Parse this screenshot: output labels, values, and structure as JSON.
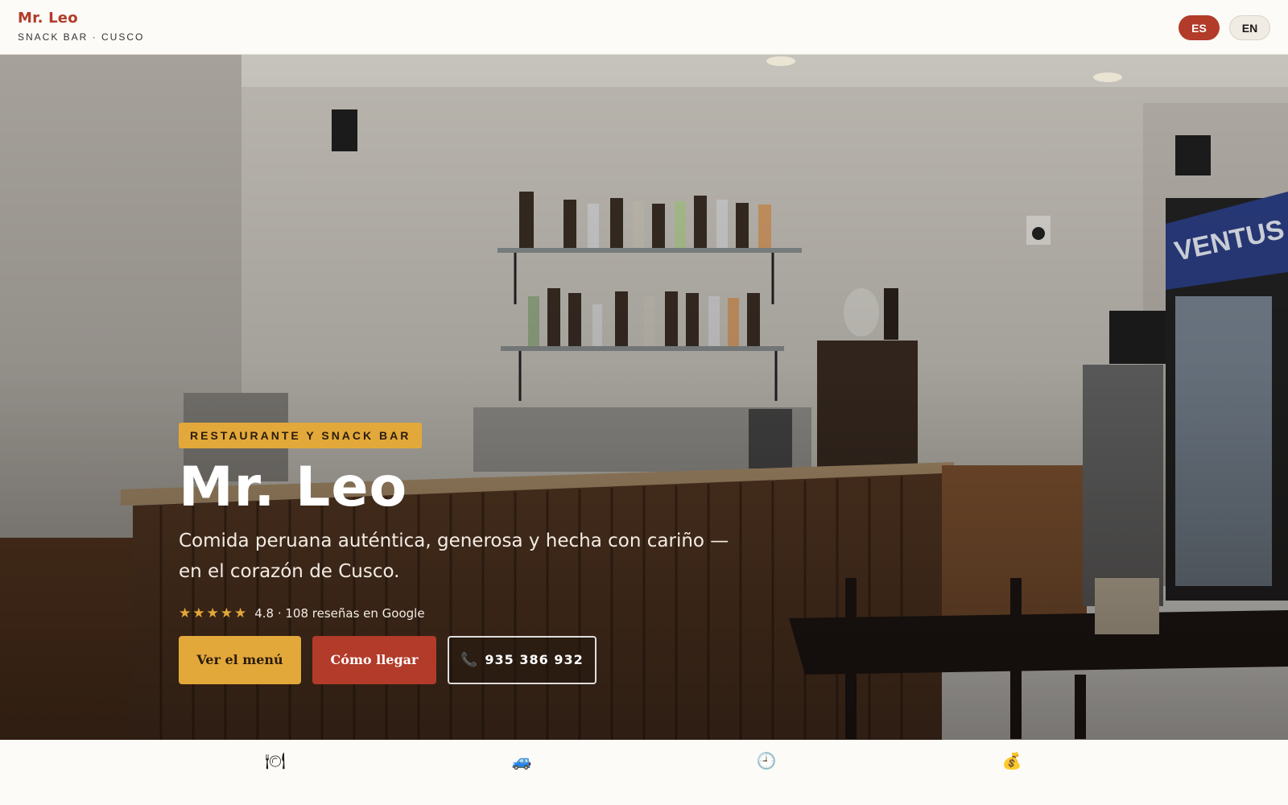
{
  "header": {
    "brand_name": "Mr. Leo",
    "brand_subtitle": "SNACK BAR · CUSCO",
    "languages": [
      {
        "code": "ES",
        "active": true
      },
      {
        "code": "EN",
        "active": false
      }
    ]
  },
  "hero": {
    "tag": "RESTAURANTE Y SNACK BAR",
    "title": "Mr. Leo",
    "subtitle": "Comida peruana auténtica, generosa y hecha con cariño — en el corazón de Cusco.",
    "rating": {
      "stars": "★★★★★",
      "text": "4.8 · 108 reseñas en Google",
      "value": 4.8
    },
    "buttons": {
      "menu": "Ver el menú",
      "directions": "Cómo llegar",
      "phone": "935 386 932"
    }
  },
  "info_strip": {
    "items": [
      {
        "icon": "plate-icon",
        "glyph": "🍽"
      },
      {
        "icon": "car-icon",
        "glyph": "🚙"
      },
      {
        "icon": "clock-icon",
        "glyph": "🕘"
      },
      {
        "icon": "money-bag-icon",
        "glyph": "💰"
      }
    ]
  },
  "colors": {
    "brand_red": "#b23b2a",
    "accent_gold": "#e3a83a",
    "background": "#fcfbf7"
  }
}
